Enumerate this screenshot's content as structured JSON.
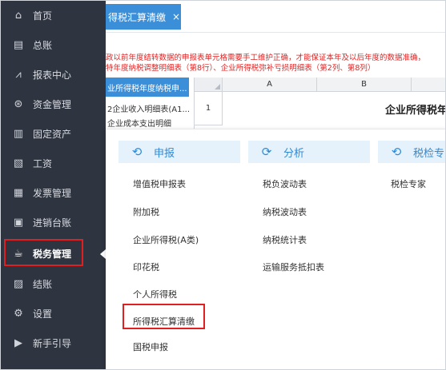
{
  "sidebar": {
    "items": [
      {
        "label": "首页",
        "icon": "home-icon"
      },
      {
        "label": "总账",
        "icon": "ledger-icon"
      },
      {
        "label": "报表中心",
        "icon": "chart-icon"
      },
      {
        "label": "资金管理",
        "icon": "money-icon"
      },
      {
        "label": "固定资产",
        "icon": "asset-icon"
      },
      {
        "label": "工资",
        "icon": "salary-icon"
      },
      {
        "label": "发票管理",
        "icon": "invoice-icon"
      },
      {
        "label": "进销台账",
        "icon": "inventory-icon"
      },
      {
        "label": "税务管理",
        "icon": "tax-icon",
        "active": true
      },
      {
        "label": "结账",
        "icon": "closing-icon"
      },
      {
        "label": "设置",
        "icon": "gear-icon"
      },
      {
        "label": "新手引导",
        "icon": "guide-icon"
      }
    ]
  },
  "tab": {
    "label": "得税汇算清缴",
    "close": "×"
  },
  "warning": {
    "line1": "政以前年度结转数据的申报表单元格需要手工维护正确，才能保证本年及以后年度的数据准确，",
    "line2": "特年度纳税调整明细表（第8行）、企业所得税弥补亏损明细表（第2列、第8列）"
  },
  "sheet_list": {
    "active": "业所得税年度纳税申...",
    "items": [
      "2企业收入明细表(A1...",
      "企业成本支出明细"
    ]
  },
  "spreadsheet": {
    "columns": [
      "A",
      "B",
      "C"
    ],
    "row_numbers": [
      "1"
    ],
    "title_cell": "企业所得税年"
  },
  "popup": {
    "categories": [
      {
        "title": "申报",
        "icon": "declare-icon",
        "items": [
          "增值税申报表",
          "附加税",
          "企业所得税(A类)",
          "印花税",
          "个人所得税",
          "所得税汇算清缴",
          "国税申报"
        ]
      },
      {
        "title": "分析",
        "icon": "analysis-icon",
        "items": [
          "税负波动表",
          "纳税波动表",
          "纳税统计表",
          "运输服务抵扣表"
        ]
      },
      {
        "title": "税检专",
        "icon": "tax-check-icon",
        "items": [
          "税检专家"
        ]
      }
    ]
  },
  "colors": {
    "sidebar_bg": "#2e3440",
    "accent": "#3b8fd9",
    "highlight": "#e02020",
    "warning_text": "#e02424"
  }
}
